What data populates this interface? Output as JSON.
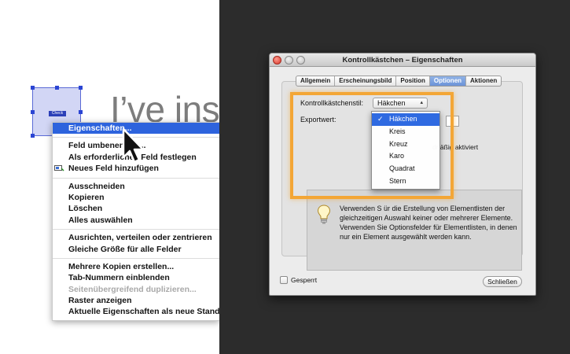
{
  "canvas": {
    "big_text": "I’ve ins",
    "field_label": "Check"
  },
  "context_menu": {
    "groups": [
      [
        {
          "label": "Eigenschaften...",
          "selected": true
        }
      ],
      [
        {
          "label": "Feld umbenennen..."
        },
        {
          "label": "Als erforderliches Feld festlegen"
        },
        {
          "label": "Neues Feld hinzufügen",
          "icon": "new-field-icon"
        }
      ],
      [
        {
          "label": "Ausschneiden"
        },
        {
          "label": "Kopieren"
        },
        {
          "label": "Löschen"
        },
        {
          "label": "Alles auswählen"
        }
      ],
      [
        {
          "label": "Ausrichten, verteilen oder zentrieren"
        },
        {
          "label": "Gleiche Größe für alle Felder"
        }
      ],
      [
        {
          "label": "Mehrere Kopien erstellen..."
        },
        {
          "label": "Tab-Nummern einblenden"
        },
        {
          "label": "Seitenübergreifend duplizieren...",
          "disabled": true
        },
        {
          "label": "Raster anzeigen"
        },
        {
          "label": "Aktuelle Eigenschaften als neue Standar"
        }
      ]
    ]
  },
  "dialog": {
    "title": "Kontrollkästchen – Eigenschaften",
    "tabs": [
      "Allgemein",
      "Erscheinungsbild",
      "Position",
      "Optionen",
      "Aktionen"
    ],
    "active_tab": "Optionen",
    "style_label": "Kontrollkästchenstil:",
    "style_value": "Häkchen",
    "export_label": "Exportwert:",
    "default_hint": "dr äßig aktiviert",
    "info_text": "Verwenden S                    ür die Erstellung von Elementlisten der gleichzeitigen Auswahl keiner oder mehrerer Elemente. Verwenden Sie Optionsfelder für Elementlisten, in denen nur ein Element ausgewählt werden kann.",
    "locked_label": "Gesperrt",
    "close_label": "Schließen",
    "dropdown": {
      "check_mark": "✓",
      "options": [
        "Häkchen",
        "Kreis",
        "Kreuz",
        "Karo",
        "Quadrat",
        "Stern"
      ],
      "selected": "Häkchen"
    }
  },
  "colors": {
    "dark_background": "#2c2c2c",
    "selection_blue": "#2d63dd",
    "highlight_orange": "#f3a636",
    "field_fill": "#d2d6f5"
  }
}
